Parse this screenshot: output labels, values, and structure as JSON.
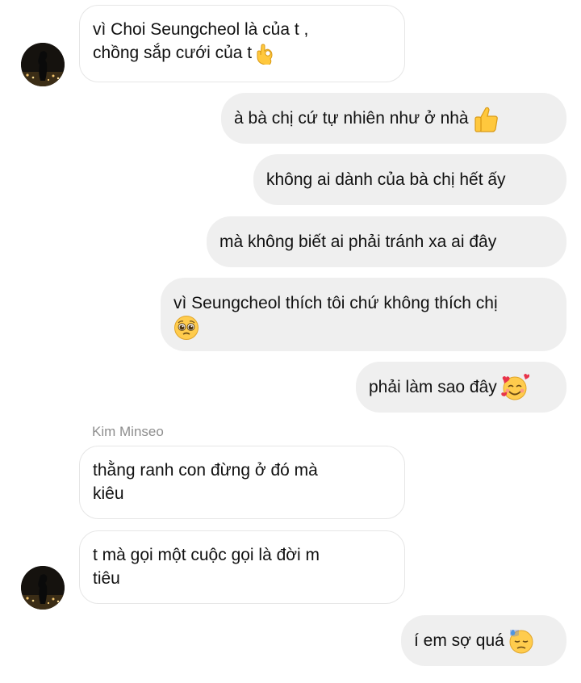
{
  "messages": [
    {
      "id": 1,
      "side": "in",
      "lines": [
        "vì Choi Seungcheol là của t ,",
        "chồng sắp cưới của t"
      ],
      "emoji": "ok-hand"
    },
    {
      "id": 2,
      "side": "out",
      "text": "à bà chị cứ tự nhiên như ở nhà",
      "emoji": "thumbs-up"
    },
    {
      "id": 3,
      "side": "out",
      "text": "không ai dành của bà chị hết ấy"
    },
    {
      "id": 4,
      "side": "out",
      "text": "mà không biết ai phải tránh xa ai đây"
    },
    {
      "id": 5,
      "side": "out",
      "lines": [
        "vì Seungcheol thích tôi chứ không thích chị"
      ],
      "emoji": "pleading-face"
    },
    {
      "id": 6,
      "side": "out",
      "text": "phải làm sao đây",
      "emoji": "smiling-face-with-hearts"
    },
    {
      "id": 7,
      "side": "in",
      "sender": "Kim Minseo",
      "lines": [
        "thằng ranh con đừng ở đó mà",
        "kiêu"
      ]
    },
    {
      "id": 8,
      "side": "in",
      "lines": [
        "t mà gọi một cuộc gọi là đời m",
        "tiêu"
      ]
    },
    {
      "id": 9,
      "side": "out",
      "text": "í em sợ quá",
      "emoji": "downcast-face-with-sweat"
    }
  ],
  "colors": {
    "outgoing_bubble": "#efefef",
    "incoming_border": "#e6e6e6",
    "sender_name": "#8e8e8e",
    "text": "#111111"
  }
}
